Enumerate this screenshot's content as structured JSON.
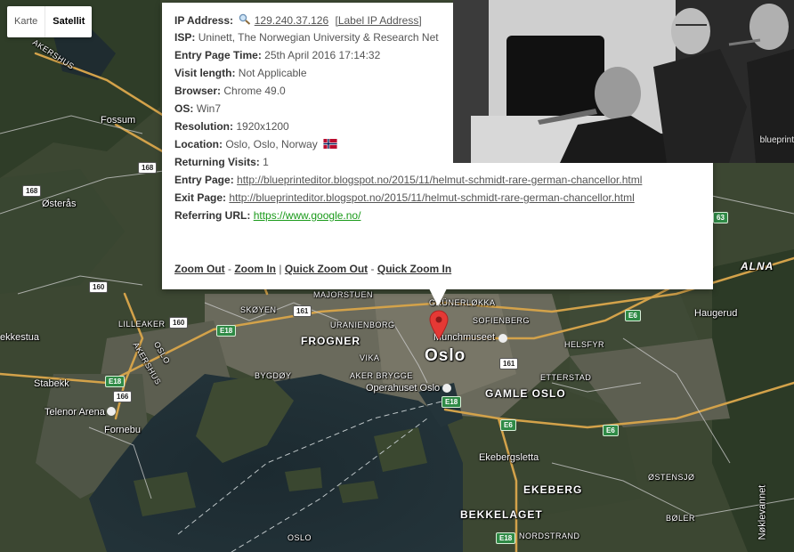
{
  "map": {
    "type_control": {
      "map_label": "Karte",
      "satellite_label": "Satellit",
      "selected": "Satellit"
    },
    "labels": {
      "akershus_nw": "AKERSHUS",
      "fossum": "Fossum",
      "osteras": "Østerås",
      "gruner": "GRÜNERLØKKA",
      "sofienberg": "SOFIENBERG",
      "munch": "Munchmuseet",
      "oslo": "Oslo",
      "frogner": "FROGNER",
      "skoyen": "SKØYEN",
      "uranienborg": "URANIENBORG",
      "majorstuen": "MAJORSTUEN",
      "lilleaker": "LILLEAKER",
      "bekkestua": "ekkestua",
      "stabekk": "Stabekk",
      "akershus_sw": "AKERSHUS",
      "oslo_sw": "OSLO",
      "bygdoy": "BYGDØY",
      "vika": "VIKA",
      "aker_brygge": "AKER BRYGGE",
      "operahuset": "Operahuset Oslo",
      "gamle_oslo": "GAMLE OSLO",
      "etterstad": "ETTERSTAD",
      "helsfyr": "HELSFYR",
      "haugerud": "Haugerud",
      "alna": "ALNA",
      "telenor": "Telenor Arena",
      "fornebu": "Fornebu",
      "ekebergsletta": "Ekebergsletta",
      "ekeberg": "EKEBERG",
      "ostensjo": "ØSTENSJØ",
      "bekkelaget": "BEKKELAGET",
      "boler": "BØLER",
      "nordstrand": "NORDSTRAND",
      "oslo_south": "OSLO",
      "noklevann": "Nøklevannet"
    },
    "shields": {
      "s168a": "168",
      "s168b": "168",
      "s160a": "160",
      "s160b": "160",
      "s161a": "161",
      "s161b": "161",
      "s166": "166",
      "e18a": "E18",
      "e18b": "E18",
      "e18c": "E18",
      "e18d": "E18",
      "e6a": "E6",
      "e6b": "E6",
      "e6c": "E6",
      "s63": "63"
    }
  },
  "info": {
    "ip_label": "IP Address:",
    "ip_value": "129.240.37.126",
    "ip_link": "[Label IP Address]",
    "isp_label": "ISP:",
    "isp_value": "Uninett, The Norwegian University & Research Net",
    "entry_time_label": "Entry Page Time:",
    "entry_time_value": "25th April 2016 17:14:32",
    "visit_length_label": "Visit length:",
    "visit_length_value": "Not Applicable",
    "browser_label": "Browser:",
    "browser_value": "Chrome 49.0",
    "os_label": "OS:",
    "os_value": "Win7",
    "resolution_label": "Resolution:",
    "resolution_value": "1920x1200",
    "location_label": "Location:",
    "location_value": "Oslo, Oslo, Norway",
    "returning_label": "Returning Visits:",
    "returning_value": "1",
    "entry_page_label": "Entry Page:",
    "entry_page_url": "http://blueprinteditor.blogspot.no/2015/11/helmut-schmidt-rare-german-chancellor.html",
    "exit_page_label": "Exit Page:",
    "exit_page_url": "http://blueprinteditor.blogspot.no/2015/11/helmut-schmidt-rare-german-chancellor.html",
    "referring_label": "Referring URL:",
    "referring_url": "https://www.google.no/",
    "zoom_out": "Zoom Out",
    "zoom_in": "Zoom In",
    "quick_zoom_out": "Quick Zoom Out",
    "quick_zoom_in": "Quick Zoom In",
    "sep_dash": "-",
    "sep_bar": "|"
  },
  "photo": {
    "caption": "blueprint"
  },
  "colors": {
    "link_green": "#1a9a1a",
    "marker_red": "#e53935",
    "e_road": "#2f8a46"
  }
}
